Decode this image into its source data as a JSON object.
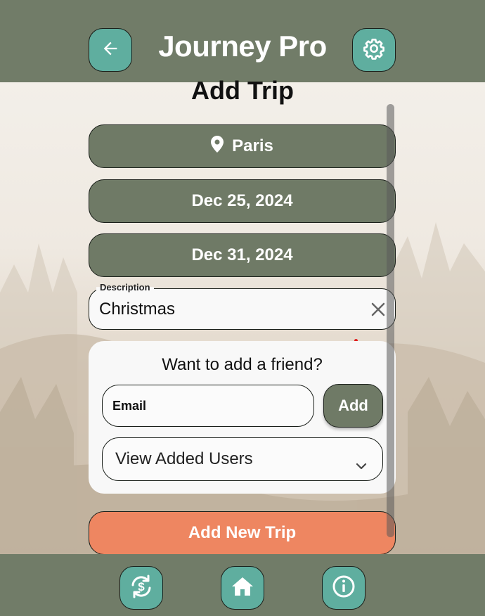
{
  "app": {
    "title": "Journey Pro"
  },
  "page": {
    "title": "Add Trip"
  },
  "trip": {
    "location": "Paris",
    "start_date": "Dec 25, 2024",
    "end_date": "Dec 31, 2024",
    "description_label": "Description",
    "description_value": "Christmas"
  },
  "friends": {
    "title": "Want to add a friend?",
    "email_placeholder": "Email",
    "add_label": "Add",
    "view_users_label": "View Added Users"
  },
  "submit": {
    "label": "Add New Trip"
  },
  "icons": {
    "back": "arrow-left-icon",
    "settings": "gear-icon",
    "location": "map-pin-icon",
    "clear": "close-icon",
    "dropdown": "chevron-down-icon",
    "sync": "currency-sync-icon",
    "home": "home-icon",
    "info": "info-icon"
  },
  "colors": {
    "header": "#717c68",
    "accent": "#5fae9f",
    "pill": "#6f7a66",
    "submit": "#ee8661"
  }
}
